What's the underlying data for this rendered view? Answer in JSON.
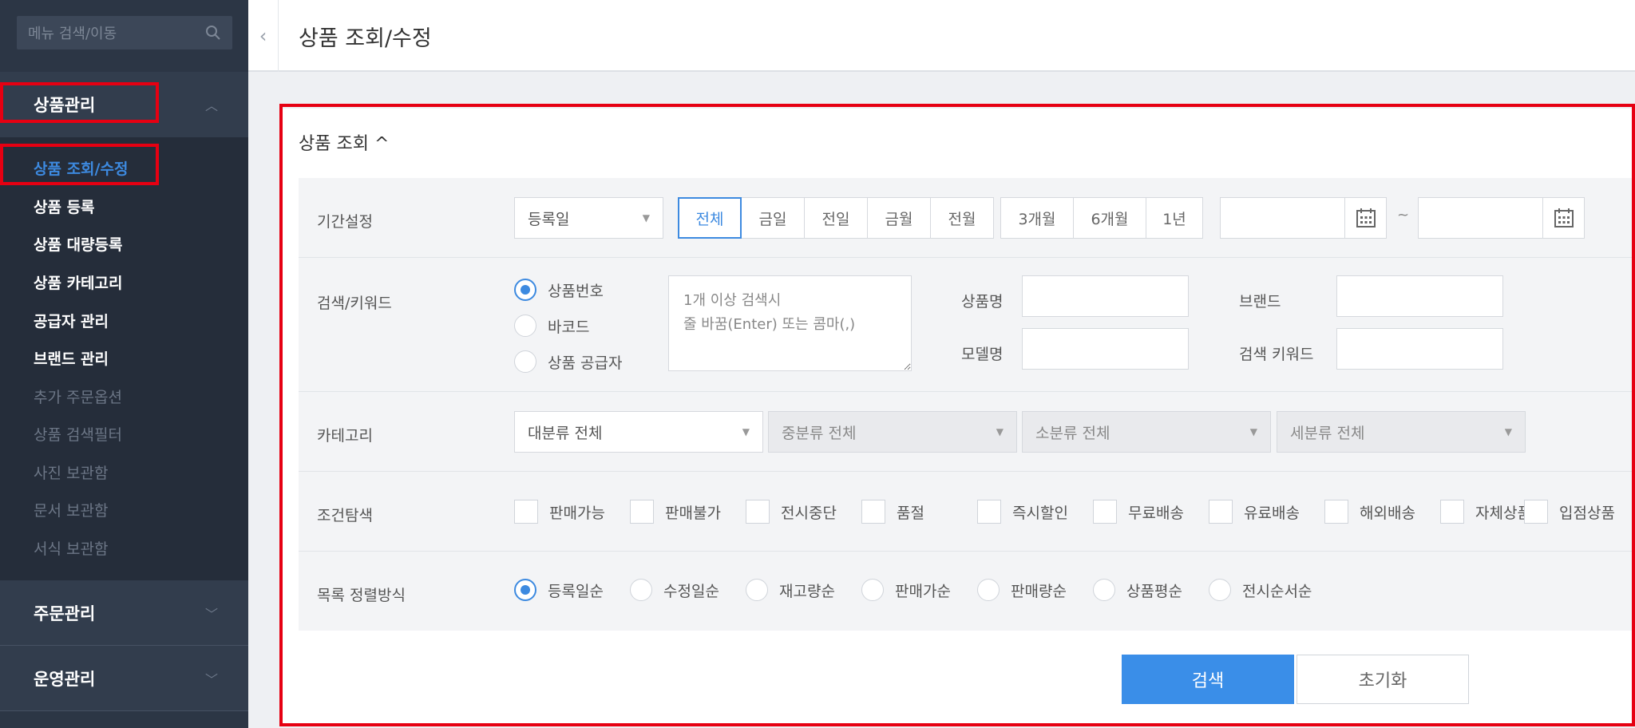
{
  "sidebar": {
    "search_placeholder": "메뉴 검색/이동",
    "groups": [
      {
        "label": "상품관리"
      },
      {
        "label": "주문관리"
      },
      {
        "label": "운영관리"
      }
    ],
    "items": [
      {
        "label": "상품 조회/수정"
      },
      {
        "label": "상품 등록"
      },
      {
        "label": "상품 대량등록"
      },
      {
        "label": "상품 카테고리"
      },
      {
        "label": "공급자 관리"
      },
      {
        "label": "브랜드 관리"
      },
      {
        "label": "추가 주문옵션"
      },
      {
        "label": "상품 검색필터"
      },
      {
        "label": "사진 보관함"
      },
      {
        "label": "문서 보관함"
      },
      {
        "label": "서식 보관함"
      }
    ]
  },
  "header": {
    "title": "상품 조회/수정"
  },
  "panel": {
    "title": "상품 조회 ^"
  },
  "period": {
    "label": "기간설정",
    "select": "등록일",
    "group1": [
      "전체",
      "금일",
      "전일",
      "금월",
      "전월"
    ],
    "group2": [
      "3개월",
      "6개월",
      "1년"
    ],
    "tilde": "~"
  },
  "keyword": {
    "label": "검색/키워드",
    "radios": [
      "상품번호",
      "바코드",
      "상품 공급자"
    ],
    "textarea_placeholder": "1개 이상 검색시\n줄 바꿈(Enter) 또는 콤마(,)",
    "fields": [
      "상품명",
      "모델명",
      "브랜드",
      "검색 키워드"
    ]
  },
  "category": {
    "label": "카테고리",
    "selects": [
      "대분류 전체",
      "중분류 전체",
      "소분류 전체",
      "세분류 전체"
    ]
  },
  "conditions": {
    "label": "조건탐색",
    "options": [
      "판매가능",
      "판매불가",
      "전시중단",
      "품절",
      "즉시할인",
      "무료배송",
      "유료배송",
      "해외배송",
      "자체상품",
      "입점상품"
    ]
  },
  "sort": {
    "label": "목록 정렬방식",
    "options": [
      "등록일순",
      "수정일순",
      "재고량순",
      "판매가순",
      "판매량순",
      "상품평순",
      "전시순서순"
    ]
  },
  "buttons": {
    "search": "검색",
    "reset": "초기화"
  },
  "colors": {
    "accent": "#3d8ae0",
    "highlight": "#e60012",
    "sidebar": "#2c3645"
  }
}
